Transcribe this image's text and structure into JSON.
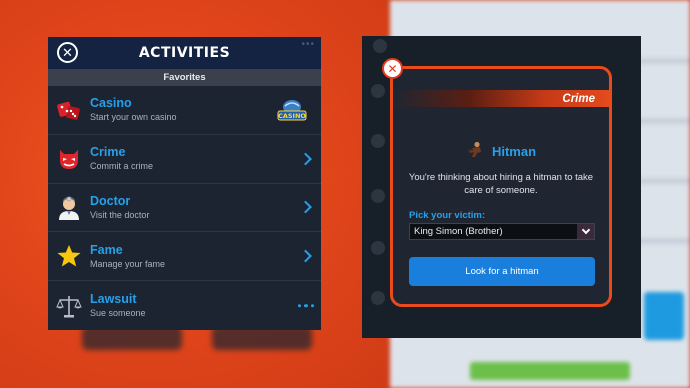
{
  "left_panel": {
    "title": "ACTIVITIES",
    "section": "Favorites",
    "items": [
      {
        "title": "Casino",
        "subtitle": "Start your own casino",
        "badge": "CASINO",
        "icon": "dice-icon"
      },
      {
        "title": "Crime",
        "subtitle": "Commit a crime",
        "icon": "devil-mask-icon"
      },
      {
        "title": "Doctor",
        "subtitle": "Visit the doctor",
        "icon": "doctor-icon"
      },
      {
        "title": "Fame",
        "subtitle": "Manage your fame",
        "icon": "star-icon"
      },
      {
        "title": "Lawsuit",
        "subtitle": "Sue someone",
        "icon": "scales-icon"
      }
    ]
  },
  "modal": {
    "category": "Crime",
    "title": "Hitman",
    "description": "You're thinking about hiring a hitman to take care of someone.",
    "pick_label": "Pick your victim:",
    "victim_value": "King Simon (Brother)",
    "button_label": "Look for a hitman"
  },
  "colors": {
    "accent_blue": "#27a0ea",
    "button_blue": "#1a7fdc",
    "modal_border": "#ea4b1c",
    "panel_bg": "#1c2431",
    "header_bg": "#132341"
  }
}
